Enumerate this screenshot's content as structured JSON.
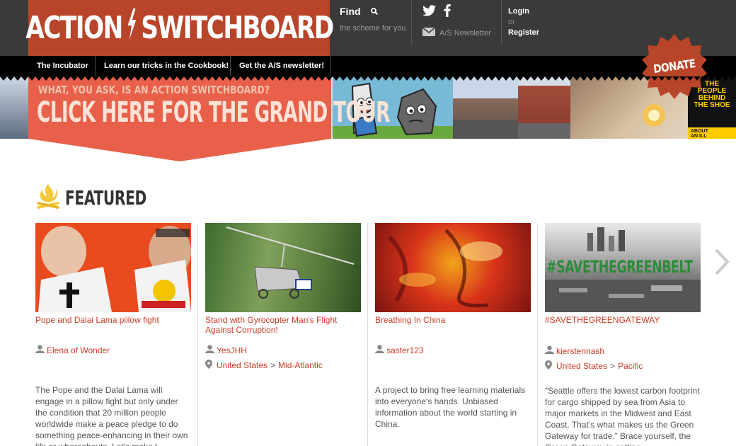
{
  "header": {
    "logo_left": "ACTION",
    "logo_right": "SWITCHBOARD",
    "find_label": "Find",
    "find_sub": "the scheme for you",
    "newsletter_label": "A/S Newsletter",
    "login": "Login",
    "or": "or",
    "register": "Register"
  },
  "nav": {
    "items": [
      "The Incubator",
      "Learn our tricks in the Cookbook!",
      "Get the A/S newsletter!"
    ]
  },
  "donate_label": "DONATE",
  "banner": {
    "question": "WHAT, YOU ASK, IS AN ACTION SWITCHBOARD?",
    "headline": "CLICK HERE FOR THE GRAND TOUR"
  },
  "featured": {
    "title": "FEATURED",
    "cards": [
      {
        "title": "Pope and Dalai Lama pillow fight",
        "author": "Elena of Wonder",
        "country": "",
        "region": "",
        "description": "The Pope and the Dalai Lama will engage in a pillow fight but only under the condition that 20 million people worldwide make a peace pledge to do something peace-enhancing in their own life or whereabouts. Let's make t"
      },
      {
        "title": "Stand with Gyrocopter Man's Flight Against Corruption!",
        "author": "YesJHH",
        "country": "United States",
        "region": "Mid-Atlantic",
        "description": ""
      },
      {
        "title": "Breathing In China",
        "author": "saster123",
        "country": "",
        "region": "",
        "description": "A project to bring free learning materials into everyone's hands. Unbiased information about the world starting in China."
      },
      {
        "title": "#SAVETHEGREENGATEWAY",
        "author": "kierstennash",
        "country": "United States",
        "region": "Pacific",
        "description": "“Seattle offers the lowest carbon footprint for cargo shipped by sea from Asia to major markets in the Midwest and East Coast. That’s what makes us the Green Gateway for trade.” Brace yourself, the Green Gateway is getting"
      }
    ],
    "card4_overlay": "#SAVETHEGREENBELT"
  },
  "banner_people": "THE PEOPLE BEHIND THE SHOE",
  "banner_about": "ABOUT AN ILL",
  "colors": {
    "brand": "#b8452a",
    "link": "#cc3b27",
    "topbar": "#3a3a3a",
    "tour": "#e8604a"
  }
}
